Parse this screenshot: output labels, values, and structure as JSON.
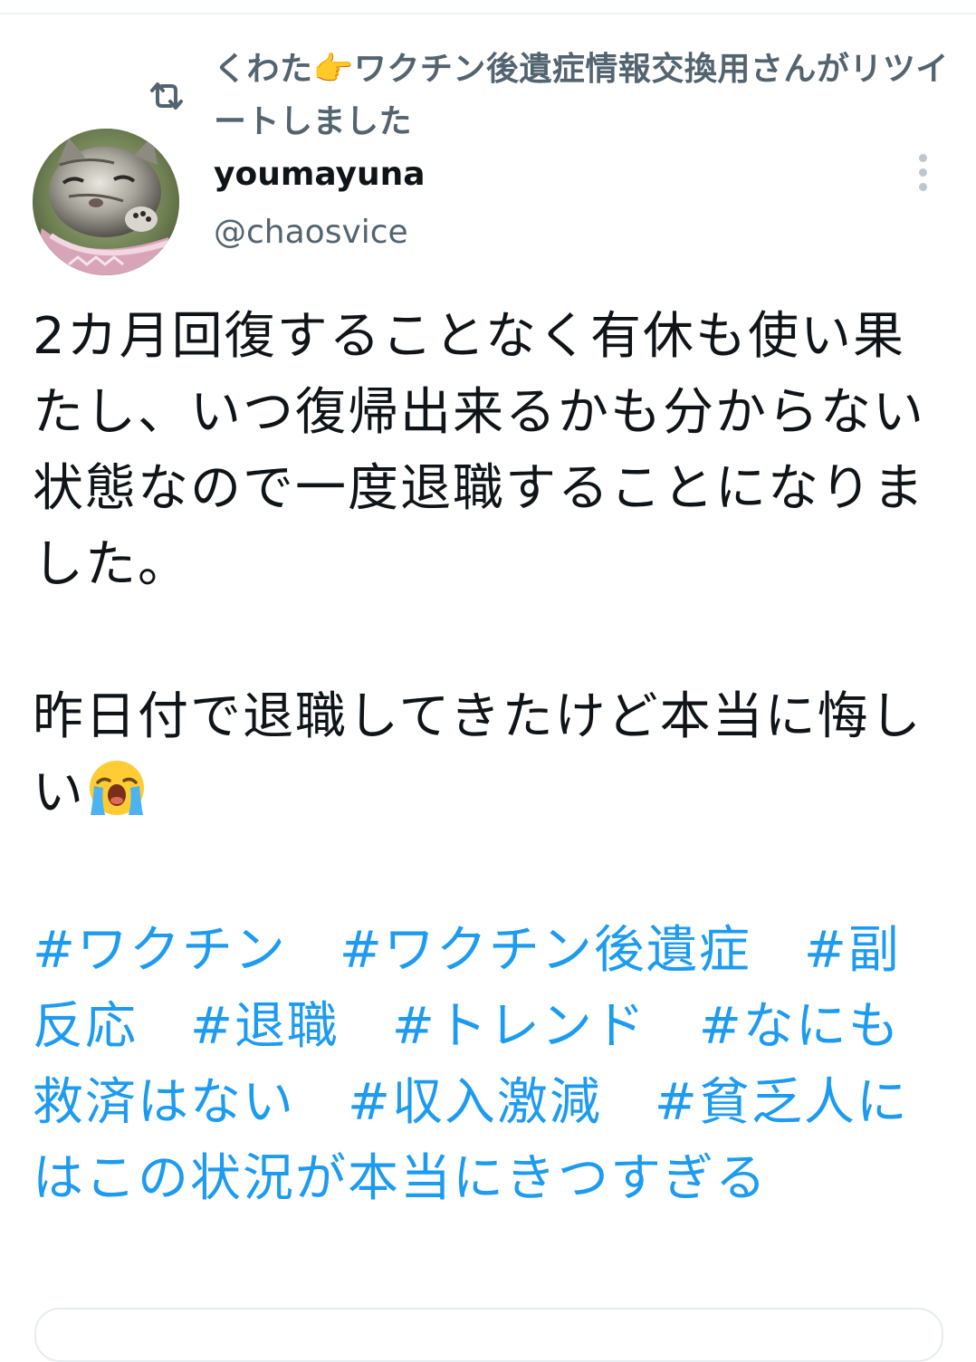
{
  "retweet": {
    "icon": "retweet-icon",
    "text": "くわた👉ワクチン後遺症情報交換用さんがリツイートしました"
  },
  "author": {
    "name": "youmayuna",
    "handle": "@chaosvice",
    "avatar_icon": "cat-avatar-icon"
  },
  "menu": {
    "icon": "more-vertical-icon"
  },
  "tweet": {
    "paragraph1": "2カ月回復することなく有休も使い果たし、いつ復帰出来るかも分からない状態なので一度退職することになりました。",
    "paragraph2": "昨日付で退職してきたけど本当に悔しい",
    "emoji": "loudly-crying-face-icon",
    "hashtags": [
      "#ワクチン",
      "#ワクチン後遺症",
      "#副反応",
      "#退職",
      "#トレンド",
      "#なにも救済はない",
      "#収入激減",
      "#貧乏人にはこの状況が本当にきつすぎる"
    ]
  },
  "colors": {
    "text": "#0f1419",
    "secondary": "#536471",
    "link": "#1d9bf0",
    "divider": "#eff3f4"
  }
}
